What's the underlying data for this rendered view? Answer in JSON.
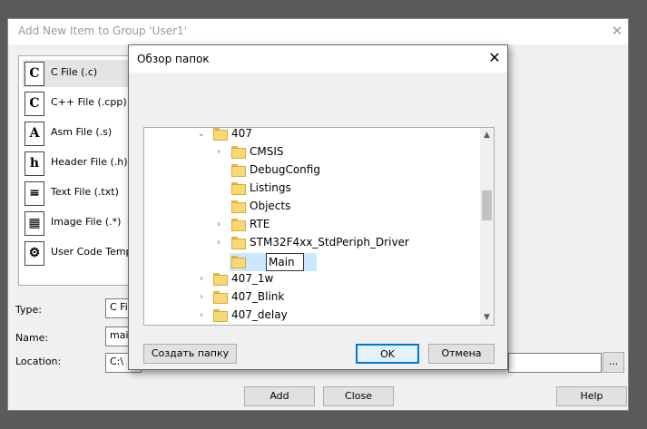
{
  "add_item_dialog": {
    "title": "Add New Item to Group 'User1'",
    "close_glyph": "✕",
    "file_types": [
      {
        "icon": "c-file-icon",
        "glyph": "C",
        "label": "C File (.c)",
        "selected": true
      },
      {
        "icon": "cpp-file-icon",
        "glyph": "C",
        "label": "C++ File (.cpp)"
      },
      {
        "icon": "asm-file-icon",
        "glyph": "A",
        "label": "Asm File (.s)"
      },
      {
        "icon": "header-file-icon",
        "glyph": "h",
        "label": "Header File (.h)"
      },
      {
        "icon": "text-file-icon",
        "glyph": "≡",
        "label": "Text File (.txt)"
      },
      {
        "icon": "image-file-icon",
        "glyph": "▦",
        "label": "Image File (.*)"
      },
      {
        "icon": "user-code-template-icon",
        "glyph": "⚙",
        "label": "User Code Templa"
      }
    ],
    "type_label": "Type:",
    "type_value": "C Fil",
    "name_label": "Name:",
    "name_value": "mai",
    "location_label": "Location:",
    "location_value": "C:\\",
    "browse_label": "...",
    "add_label": "Add",
    "close_label": "Close",
    "help_label": "Help"
  },
  "folder_dialog": {
    "title": "Обзор папок",
    "close_glyph": "✕",
    "tree": [
      {
        "name": "407",
        "level": 0,
        "expander": "expanded"
      },
      {
        "name": "CMSIS",
        "level": 1,
        "expander": "collapsed"
      },
      {
        "name": "DebugConfig",
        "level": 1,
        "expander": "none"
      },
      {
        "name": "Listings",
        "level": 1,
        "expander": "none"
      },
      {
        "name": "Objects",
        "level": 1,
        "expander": "none"
      },
      {
        "name": "RTE",
        "level": 1,
        "expander": "collapsed"
      },
      {
        "name": "STM32F4xx_StdPeriph_Driver",
        "level": 1,
        "expander": "collapsed"
      },
      {
        "name": "",
        "level": 1,
        "expander": "none",
        "editing": true
      },
      {
        "name": "407_1w",
        "level": 0,
        "expander": "collapsed"
      },
      {
        "name": "407_Blink",
        "level": 0,
        "expander": "collapsed"
      },
      {
        "name": "407_delay",
        "level": 0,
        "expander": "collapsed"
      }
    ],
    "rename_value": "Main",
    "new_folder_label": "Создать папку",
    "ok_label": "OK",
    "cancel_label": "Отмена"
  },
  "colors": {
    "folder": "#f8d775",
    "selection": "#cce8ff",
    "accent": "#0078d7"
  }
}
